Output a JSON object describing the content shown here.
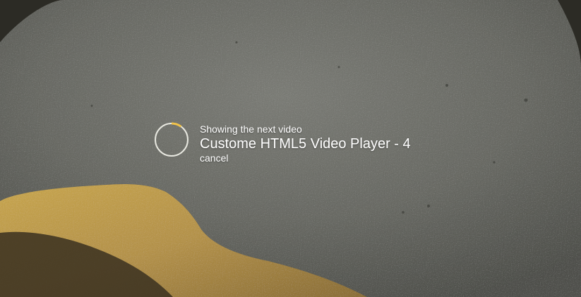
{
  "overlay": {
    "label": "Showing the next video",
    "title": "Custome HTML5 Video Player - 4",
    "cancel": "cancel",
    "countdown_progress": 0.1
  },
  "colors": {
    "countdown_track": "#e8e8e0",
    "countdown_progress": "#f0c24a",
    "text": "#ffffff"
  }
}
